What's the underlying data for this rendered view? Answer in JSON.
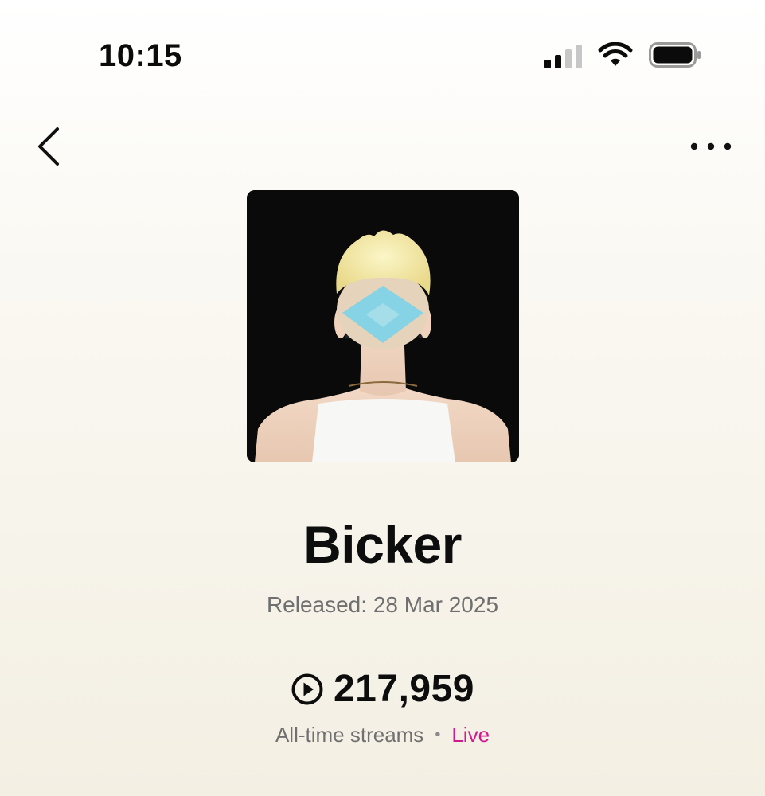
{
  "status_bar": {
    "time": "10:15",
    "icons": [
      "cellular-signal-icon",
      "wifi-icon",
      "battery-icon"
    ]
  },
  "nav": {
    "back_icon": "chevron-left-icon",
    "more_icon": "ellipsis-icon"
  },
  "track": {
    "title": "Bicker",
    "released": "Released: 28 Mar 2025",
    "streams": "217,959",
    "streams_caption": "All-time streams",
    "separator": "•",
    "live_label": "Live"
  },
  "colors": {
    "live_accent": "#d21a8f",
    "album_hair_blue": "#7fd3e6"
  }
}
